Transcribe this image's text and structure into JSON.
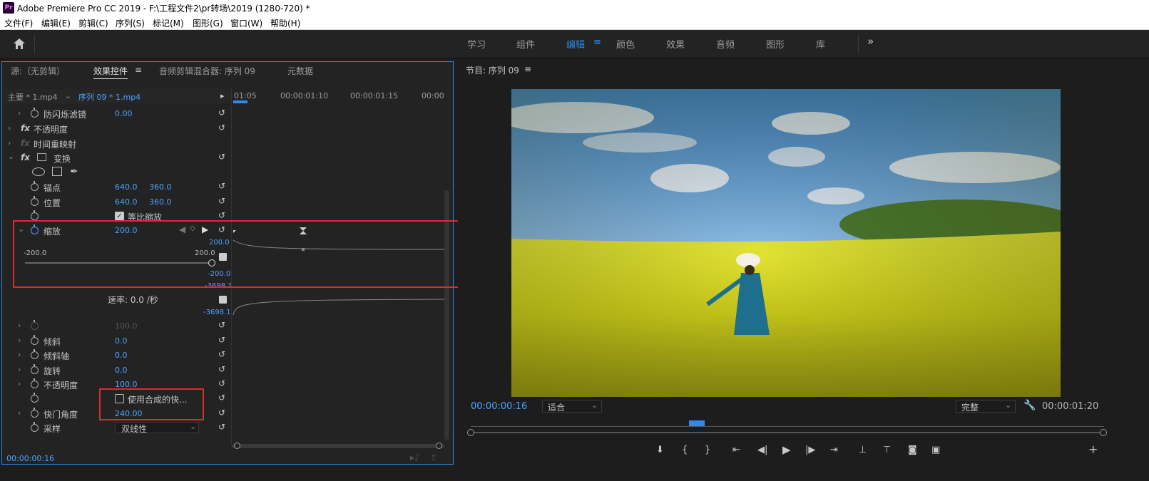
{
  "window": {
    "title": "Adobe Premiere Pro CC 2019 - F:\\工程文件2\\pr转场\\2019 (1280-720)  *",
    "logo": "Pr"
  },
  "menu": [
    "文件(F)",
    "编辑(E)",
    "剪辑(C)",
    "序列(S)",
    "标记(M)",
    "图形(G)",
    "窗口(W)",
    "帮助(H)"
  ],
  "workspaces": {
    "items": [
      "学习",
      "组件",
      "编辑",
      "颜色",
      "效果",
      "音频",
      "图形",
      "库"
    ],
    "active": "编辑",
    "more": "»"
  },
  "left_panel": {
    "tabs": [
      "源:（无剪辑）",
      "效果控件",
      "音频剪辑混合器: 序列 09",
      "元数据"
    ],
    "active_tab": "效果控件",
    "master_clip": "主要 * 1.mp4",
    "sequence_clip": "序列 09 * 1.mp4",
    "timecodes": [
      "01:05",
      "00:00:01:10",
      "00:00:01:15",
      "00:00"
    ],
    "properties": {
      "anti_flicker": {
        "label": "防闪烁滤镜",
        "value": "0.00"
      },
      "opacity_fx": "不透明度",
      "time_remap": "时间重映射",
      "transform": "变换",
      "anchor": {
        "label": "锚点",
        "x": "640.0",
        "y": "360.0"
      },
      "position": {
        "label": "位置",
        "x": "640.0",
        "y": "360.0"
      },
      "uniform_scale": "等比缩放",
      "scale": {
        "label": "缩放",
        "value": "200.0",
        "min": "-200.0",
        "max": "200.0",
        "graph_top": "200.0",
        "graph_bottom": "-200.0",
        "graph_min": "-3698.1"
      },
      "velocity": {
        "label": "速率: 0.0 /秒",
        "value": "-3698.1"
      },
      "scale_width": "100.0",
      "skew": {
        "label": "倾斜",
        "value": "0.0"
      },
      "skew_axis": {
        "label": "倾斜轴",
        "value": "0.0"
      },
      "rotation": {
        "label": "旋转",
        "value": "0.0"
      },
      "opacity": {
        "label": "不透明度",
        "value": "100.0"
      },
      "use_composite": "使用合成的快...",
      "shutter_angle": {
        "label": "快门角度",
        "value": "240.00"
      },
      "sampling": {
        "label": "采样",
        "value": "双线性"
      }
    },
    "current_time": "00:00:00:16"
  },
  "program_monitor": {
    "title": "节目: 序列 09",
    "timecode": "00:00:00:16",
    "zoom": "适合",
    "quality": "完整",
    "duration": "00:00:01:20"
  }
}
